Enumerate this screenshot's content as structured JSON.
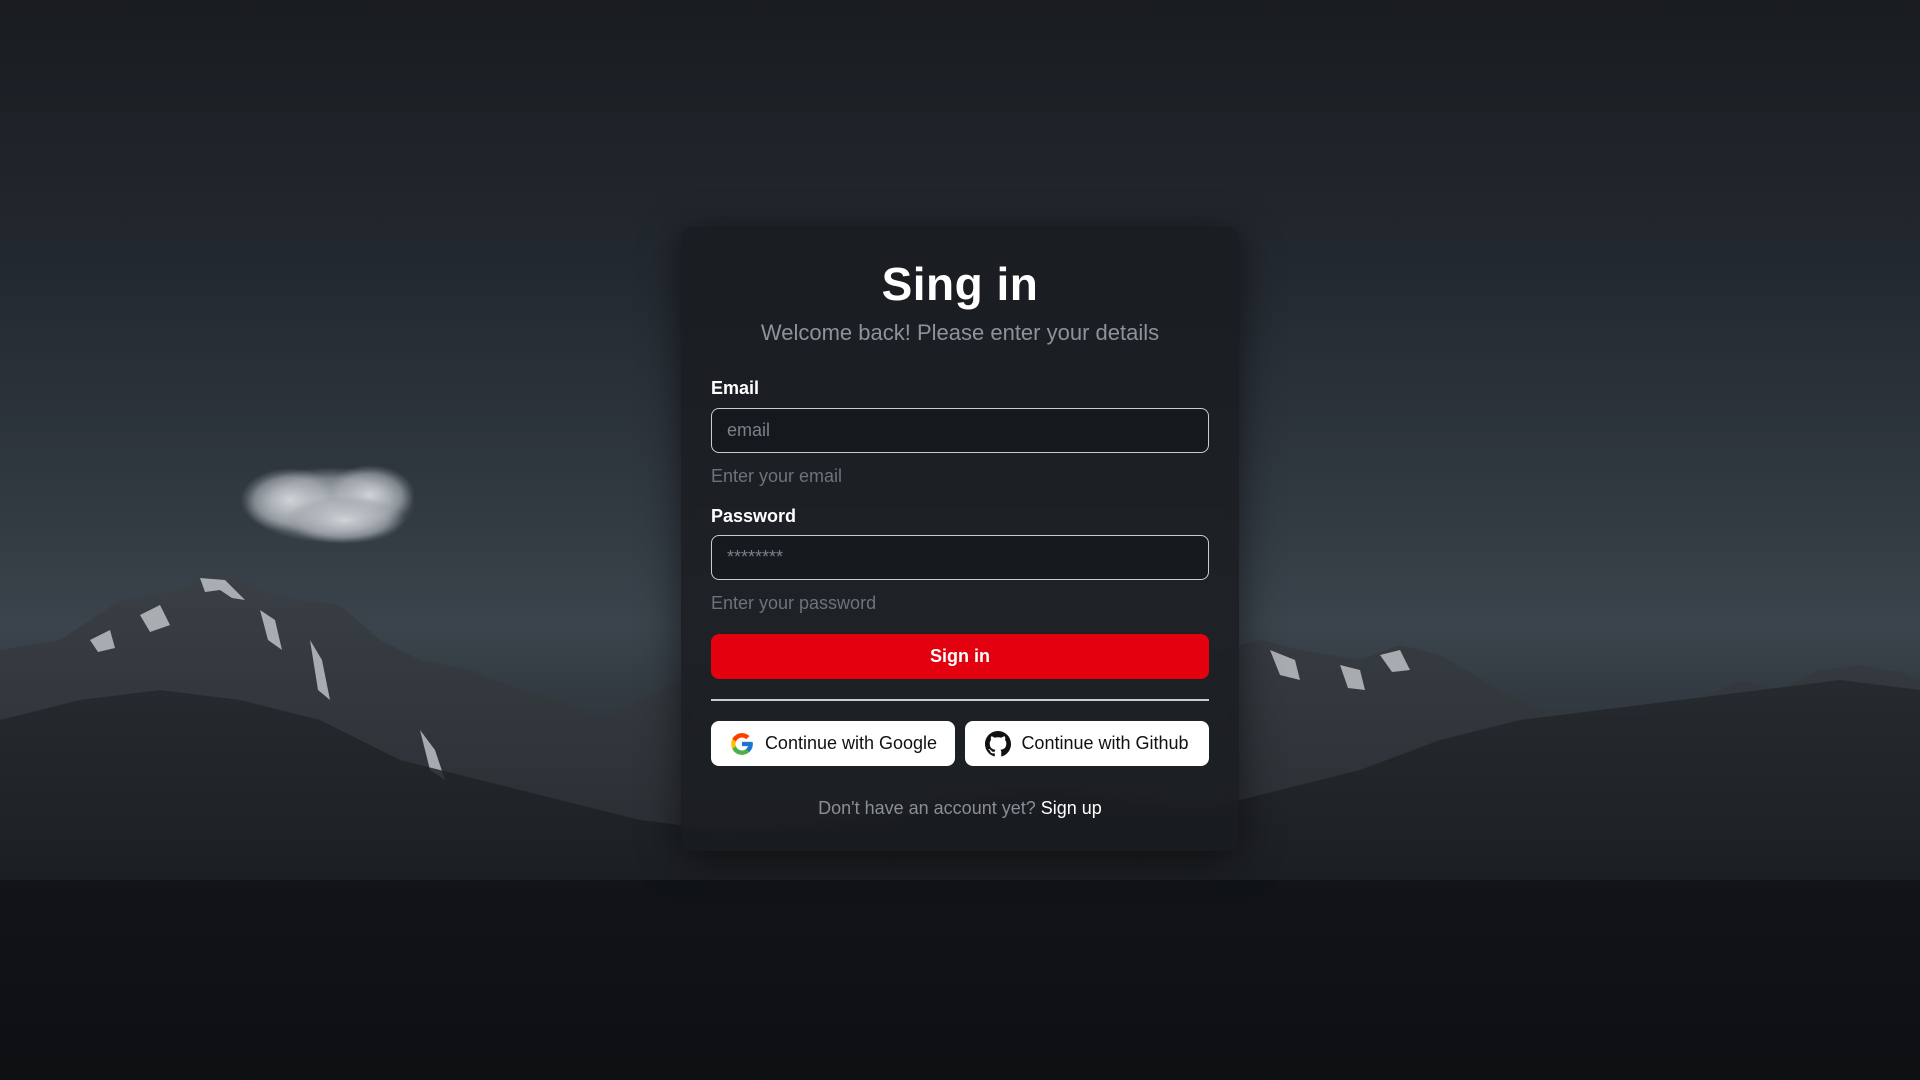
{
  "card": {
    "title": "Sing in",
    "subtitle": "Welcome back! Please enter your details"
  },
  "email": {
    "label": "Email",
    "placeholder": "email",
    "hint": "Enter your email"
  },
  "password": {
    "label": "Password",
    "placeholder": "********",
    "hint": "Enter your password"
  },
  "buttons": {
    "signin_label": "Sign in",
    "google_label": "Continue with Google",
    "github_label": "Continue with Github"
  },
  "footer": {
    "prompt": "Don't have an account yet?",
    "signup_label": "Sign up"
  },
  "icons": {
    "google": "google-icon",
    "github": "github-icon"
  },
  "colors": {
    "accent": "#e3000f",
    "card_bg": "#181b1f",
    "text_muted": "#8e939a"
  }
}
